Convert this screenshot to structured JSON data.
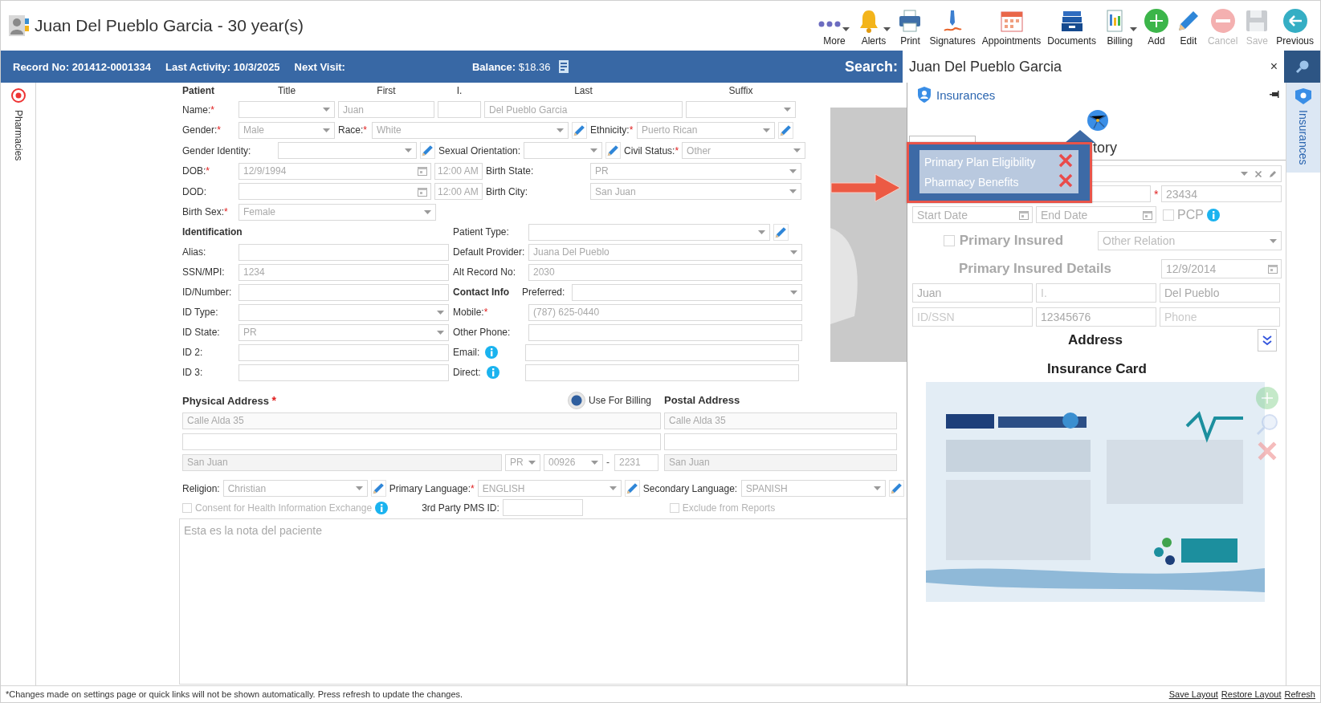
{
  "header": {
    "title": "Juan Del Pueblo Garcia - 30 year(s)"
  },
  "toolbar": [
    {
      "kind": "more",
      "label": "More",
      "caret": true,
      "disabled": false
    },
    {
      "kind": "alerts",
      "label": "Alerts",
      "caret": true,
      "disabled": false
    },
    {
      "kind": "print",
      "label": "Print",
      "caret": false,
      "disabled": false
    },
    {
      "kind": "signatures",
      "label": "Signatures",
      "caret": false,
      "disabled": false
    },
    {
      "kind": "appointments",
      "label": "Appointments",
      "caret": false,
      "disabled": false
    },
    {
      "kind": "documents",
      "label": "Documents",
      "caret": false,
      "disabled": false
    },
    {
      "kind": "billing",
      "label": "Billing",
      "caret": true,
      "disabled": false
    },
    {
      "kind": "add",
      "label": "Add",
      "caret": false,
      "disabled": false
    },
    {
      "kind": "edit",
      "label": "Edit",
      "caret": false,
      "disabled": false
    },
    {
      "kind": "cancel",
      "label": "Cancel",
      "caret": false,
      "disabled": true
    },
    {
      "kind": "save",
      "label": "Save",
      "caret": false,
      "disabled": true
    },
    {
      "kind": "previous",
      "label": "Previous",
      "caret": false,
      "disabled": false
    }
  ],
  "info_bar": {
    "items": [
      {
        "label": "Record No:",
        "value": "201412-0001334"
      },
      {
        "label": "Last Activity:",
        "value": "10/3/2025"
      },
      {
        "label": "Next Visit:"
      }
    ],
    "balance": {
      "label": "Balance:",
      "value": "$18.36"
    },
    "search": {
      "label": "Search:",
      "value": "Juan Del Pueblo Garcia",
      "clear": "×"
    }
  },
  "left_tab": {
    "label": "Pharmacies"
  },
  "right_tab": {
    "label": "Insurances",
    "selected": true
  },
  "patient": {
    "column_titles": [
      {
        "kind": "heading",
        "text": "Patient"
      },
      {
        "kind": "title",
        "text": "Title"
      },
      {
        "kind": "title",
        "text": "First"
      },
      {
        "kind": "title",
        "text": "I."
      },
      {
        "kind": "title",
        "text": "Last"
      },
      {
        "kind": "title",
        "text": "Suffix"
      }
    ],
    "rows": [
      [
        {
          "kind": "label",
          "text": "Name:",
          "mark": "*"
        },
        {
          "kind": "select"
        },
        {
          "kind": "text",
          "value": "Juan"
        },
        {
          "kind": "text"
        },
        {
          "kind": "text",
          "value": "Del Pueblo Garcia"
        },
        {
          "kind": "select"
        }
      ],
      [
        {
          "kind": "label",
          "text": "Gender:",
          "mark": "*"
        },
        {
          "kind": "select",
          "value": "Male"
        },
        {
          "kind": "label",
          "text": "Race:",
          "mark": "*"
        },
        {
          "kind": "select",
          "value": "White"
        },
        {
          "kind": "edit"
        },
        {
          "kind": "label",
          "text": "Ethnicity:",
          "mark": "*"
        },
        {
          "kind": "select",
          "value": "Puerto Rican"
        },
        {
          "kind": "edit"
        }
      ],
      [
        {
          "kind": "label",
          "text": "Gender Identity:"
        },
        {
          "kind": "select"
        },
        {
          "kind": "edit"
        },
        {
          "kind": "label",
          "text": "Sexual Orientation:"
        },
        {
          "kind": "select"
        },
        {
          "kind": "edit"
        },
        {
          "kind": "label",
          "text": "Civil Status:",
          "mark": "*"
        },
        {
          "kind": "select",
          "value": "Other"
        }
      ],
      [
        {
          "kind": "label",
          "text": "DOB:",
          "mark": "*"
        },
        {
          "kind": "date",
          "value": "12/9/1994"
        },
        {
          "kind": "text",
          "value": "12:00 AM"
        },
        {
          "kind": "label",
          "text": "Birth State:"
        },
        {
          "kind": "select",
          "value": "PR"
        }
      ],
      [
        {
          "kind": "label",
          "text": "DOD:"
        },
        {
          "kind": "date"
        },
        {
          "kind": "text",
          "value": "12:00 AM"
        },
        {
          "kind": "label",
          "text": "Birth City:"
        },
        {
          "kind": "select",
          "value": "San Juan"
        }
      ],
      [
        {
          "kind": "label",
          "text": "Birth Sex:",
          "mark": "*"
        },
        {
          "kind": "select",
          "value": "Female"
        }
      ]
    ],
    "left_rows": [
      [
        {
          "kind": "heading",
          "text": "Identification"
        }
      ],
      [
        {
          "kind": "label",
          "text": "Alias:"
        },
        {
          "kind": "text"
        }
      ],
      [
        {
          "kind": "label",
          "text": "SSN/MPI:"
        },
        {
          "kind": "text",
          "value": "1234"
        }
      ],
      [
        {
          "kind": "label",
          "text": "ID/Number:"
        },
        {
          "kind": "text"
        }
      ],
      [
        {
          "kind": "label",
          "text": "ID Type:"
        },
        {
          "kind": "select"
        }
      ],
      [
        {
          "kind": "label",
          "text": "ID State:"
        },
        {
          "kind": "select",
          "value": "PR"
        }
      ],
      [
        {
          "kind": "label",
          "text": "ID 2:"
        },
        {
          "kind": "text"
        }
      ],
      [
        {
          "kind": "label",
          "text": "ID 3:"
        },
        {
          "kind": "text"
        }
      ]
    ],
    "right_rows": [
      [
        {
          "kind": "label",
          "text": "Patient Type:"
        },
        {
          "kind": "select"
        },
        {
          "kind": "edit"
        }
      ],
      [
        {
          "kind": "label",
          "text": "Default Provider:"
        },
        {
          "kind": "select",
          "value": "Juana Del Pueblo"
        }
      ],
      [
        {
          "kind": "label",
          "text": "Alt Record No:"
        },
        {
          "kind": "text",
          "value": "2030"
        }
      ],
      [
        {
          "kind": "heading",
          "text": "Contact Info"
        },
        {
          "kind": "label",
          "text": "Preferred:"
        },
        {
          "kind": "select"
        }
      ],
      [
        {
          "kind": "label",
          "text": "Mobile:",
          "mark": "*"
        },
        {
          "kind": "text",
          "value": "(787) 625-0440"
        }
      ],
      [
        {
          "kind": "label",
          "text": "Other Phone:"
        },
        {
          "kind": "text"
        }
      ],
      [
        {
          "kind": "label",
          "text": "Email:"
        },
        {
          "kind": "info"
        },
        {
          "kind": "text"
        }
      ],
      [
        {
          "kind": "label",
          "text": "Direct:"
        },
        {
          "kind": "info"
        },
        {
          "kind": "text"
        }
      ]
    ],
    "physical_address": {
      "title": "Physical Address",
      "mark": "*",
      "line_1": "Calle Alda 35",
      "city": "San Juan",
      "state": "PR",
      "zip": "00926",
      "zip_separator": "-",
      "zip_ext": "2231"
    },
    "use_for_billing": {
      "label": "Use For Billing",
      "selected": true
    },
    "postal_address": {
      "title": "Postal Address",
      "line_1": "Calle Alda 35",
      "city": "San Juan"
    },
    "languages": [
      {
        "kind": "label",
        "text": "Religion:"
      },
      {
        "kind": "select",
        "value": "Christian"
      },
      {
        "kind": "edit"
      },
      {
        "kind": "label",
        "text": "Primary Language:",
        "mark": "*"
      },
      {
        "kind": "select",
        "value": "ENGLISH"
      },
      {
        "kind": "edit"
      },
      {
        "kind": "label",
        "text": "Secondary Language:"
      },
      {
        "kind": "select",
        "value": "SPANISH"
      },
      {
        "kind": "edit"
      }
    ],
    "consent": {
      "label": "Consent for Health Information Exchange",
      "checked": false
    },
    "pms_id": {
      "label": "3rd Party PMS ID:"
    },
    "exclude": {
      "label": "Exclude from Reports",
      "checked": false
    },
    "notes": "Esta es la nota del paciente"
  },
  "insurance": {
    "title": "Insurances",
    "tabs": [
      {
        "selected": true
      },
      {
        "label": "tory",
        "selected": false
      }
    ],
    "eligibility": [
      {
        "label": "Primary Plan Eligibility",
        "eligible": false
      },
      {
        "label": "Pharmacy Benefits",
        "eligible": false
      }
    ],
    "member_id": {
      "mark": "*",
      "value": "23434"
    },
    "start_date": {
      "placeholder": "Start Date"
    },
    "end_date": {
      "placeholder": "End Date"
    },
    "pcp": {
      "label": "PCP",
      "checked": false
    },
    "primary_insured": {
      "label": "Primary Insured",
      "checked": false
    },
    "relation": {
      "value": "Other Relation"
    },
    "details_title": "Primary Insured Details",
    "birth_date": "12/9/2014",
    "first": {
      "value": "Juan"
    },
    "middle": {
      "placeholder": "I."
    },
    "last": {
      "value": "Del Pueblo"
    },
    "id": {
      "placeholder": "ID/SSN"
    },
    "number": {
      "value": "12345676"
    },
    "phone": {
      "placeholder": "Phone"
    },
    "address_title": "Address",
    "card_title": "Insurance Card"
  },
  "footer": {
    "note": "*Changes made on settings page or quick links will not be shown automatically. Press refresh to update the changes.",
    "links": [
      "Save Layout",
      "Restore Layout",
      "Refresh"
    ]
  }
}
